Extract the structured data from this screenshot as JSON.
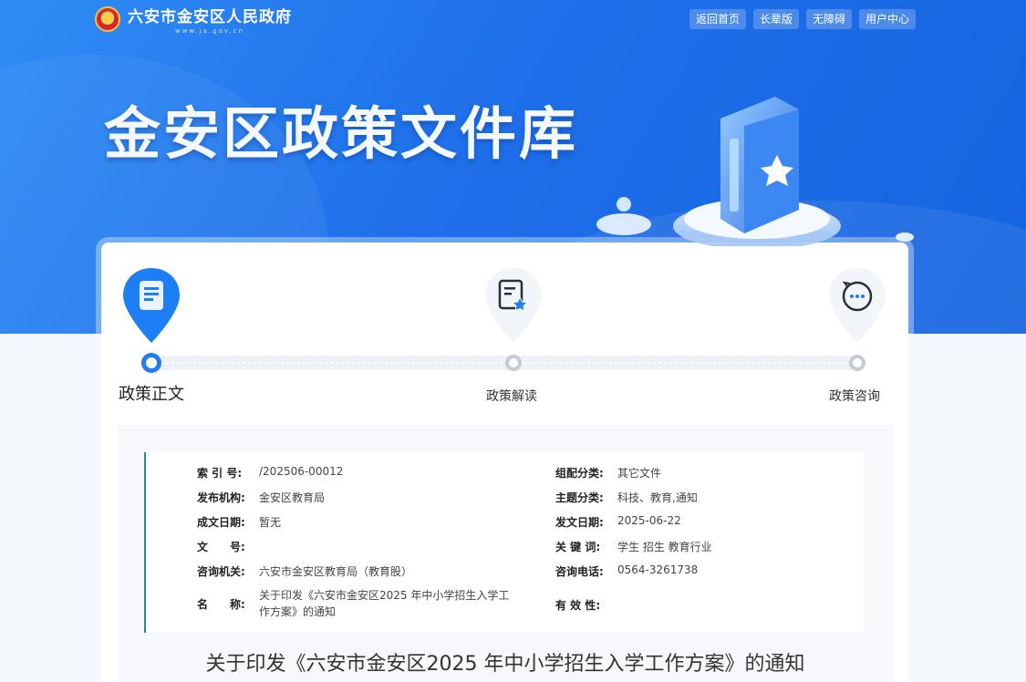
{
  "header": {
    "site_title": "六安市金安区人民政府",
    "site_url": "www.ja.gov.cn",
    "nav": [
      "返回首页",
      "长辈版",
      "无障碍",
      "用户中心"
    ]
  },
  "hero": {
    "title": "金安区政策文件库"
  },
  "steps": [
    {
      "label": "政策正文",
      "active": true
    },
    {
      "label": "政策解读",
      "active": false
    },
    {
      "label": "政策咨询",
      "active": false
    }
  ],
  "meta_left": [
    {
      "key": "索 引 号:",
      "value": "/202506-00012"
    },
    {
      "key": "发布机构:",
      "value": "金安区教育局"
    },
    {
      "key": "成文日期:",
      "value": "暂无"
    },
    {
      "key": "文　　号:",
      "value": ""
    },
    {
      "key": "咨询机关:",
      "value": "六安市金安区教育局（教育股）"
    },
    {
      "key": "名　　称:",
      "value": "关于印发《六安市金安区2025 年中小学招生入学工作方案》的通知"
    }
  ],
  "meta_right": [
    {
      "key": "组配分类:",
      "value": "其它文件"
    },
    {
      "key": "主题分类:",
      "value": "科技、教育,通知"
    },
    {
      "key": "发文日期:",
      "value": "2025-06-22"
    },
    {
      "key": "关 键 词:",
      "value": "学生 招生 教育行业"
    },
    {
      "key": "咨询电话:",
      "value": "0564-3261738"
    },
    {
      "key": "有 效 性:",
      "value": ""
    }
  ],
  "document": {
    "title": "关于印发《六安市金安区2025 年中小学招生入学工作方案》的通知"
  },
  "colors": {
    "primary": "#1e7ef5",
    "accent_line": "#2a8b86"
  }
}
